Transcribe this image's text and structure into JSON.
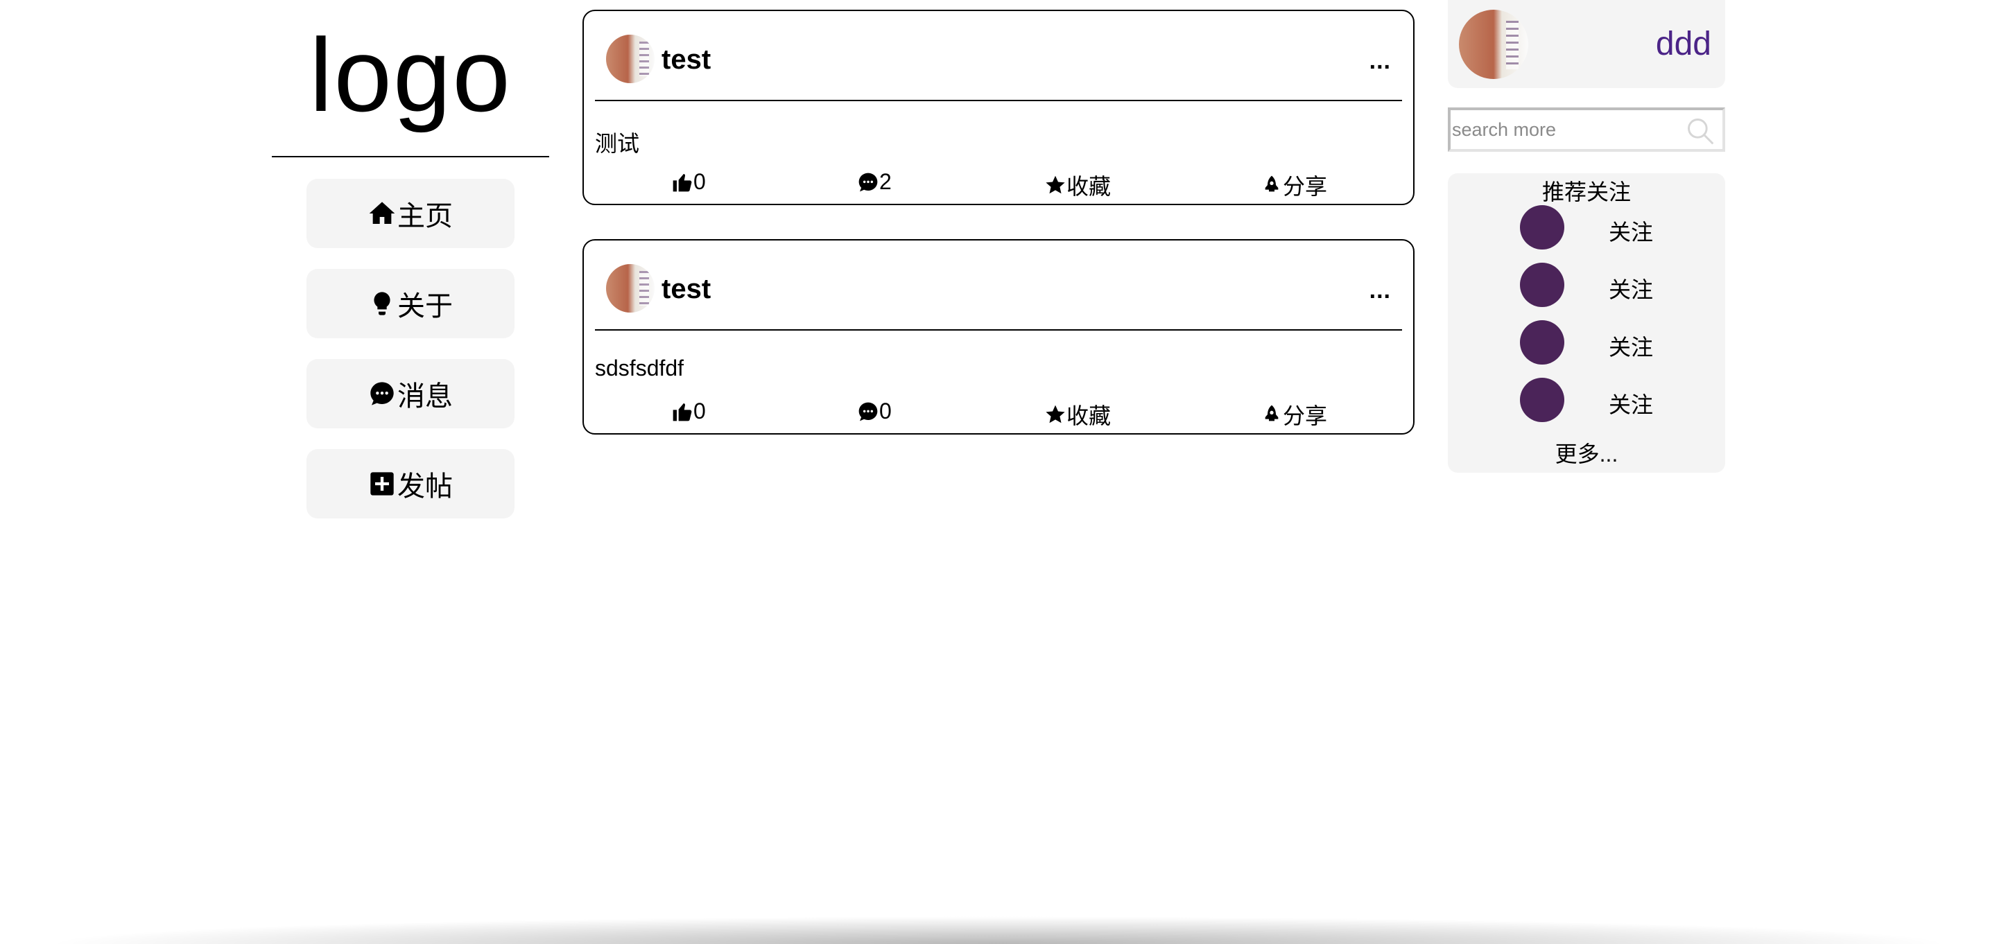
{
  "logo": "logo",
  "nav": {
    "items": [
      {
        "icon": "home-icon",
        "label": "主页"
      },
      {
        "icon": "lightbulb-icon",
        "label": "关于"
      },
      {
        "icon": "message-icon",
        "label": "消息"
      },
      {
        "icon": "add-post-icon",
        "label": "发帖"
      }
    ]
  },
  "posts": [
    {
      "user": "test",
      "more": "...",
      "content": "测试",
      "likes": "0",
      "comments": "2",
      "favorite_label": "收藏",
      "share_label": "分享"
    },
    {
      "user": "test",
      "more": "...",
      "content": "sdsfsdfdf",
      "likes": "0",
      "comments": "0",
      "favorite_label": "收藏",
      "share_label": "分享"
    }
  ],
  "profile": {
    "name": "ddd",
    "name_color": "#4b2487"
  },
  "search": {
    "placeholder": "search more",
    "value": ""
  },
  "recommend": {
    "title": "推荐关注",
    "follow_labels": [
      "关注",
      "关注",
      "关注",
      "关注"
    ],
    "avatar_color": "#4b2459",
    "more": "更多..."
  }
}
